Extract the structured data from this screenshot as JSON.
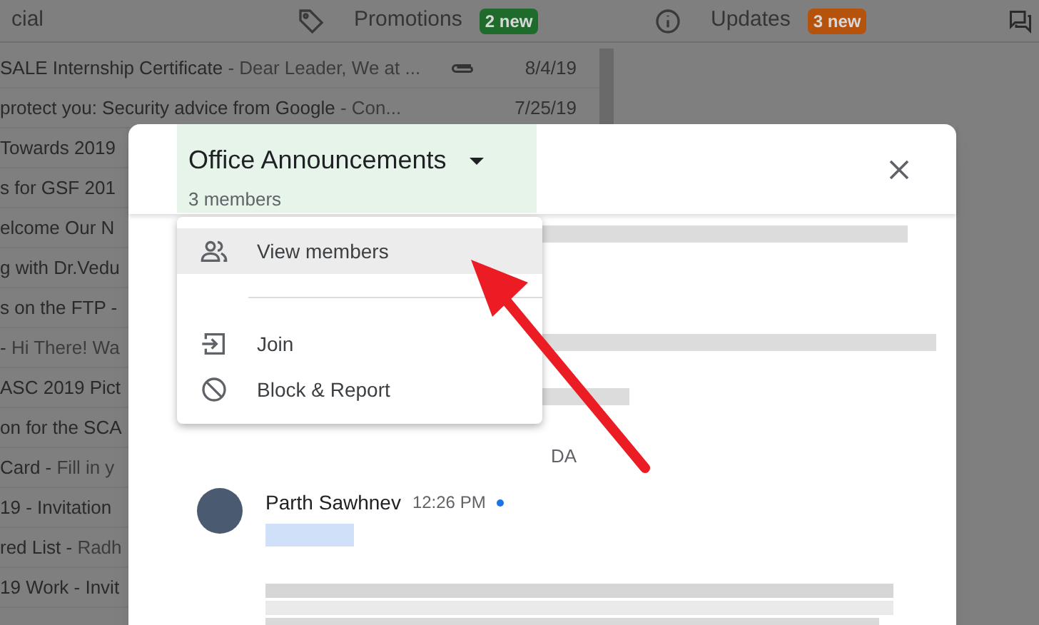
{
  "tabs": [
    {
      "label": "cial"
    },
    {
      "label": "Promotions",
      "badge": "2 new",
      "color": "#1e6b2c"
    },
    {
      "label": "Updates",
      "badge": "3 new",
      "color": "#b5520c"
    }
  ],
  "emails": [
    {
      "subject": "SALE Internship Certificate",
      "snippet": " - Dear Leader, We at ...",
      "attachment": true,
      "date": "8/4/19"
    },
    {
      "subject": "protect you: Security advice from Google",
      "snippet": " - Con...",
      "attachment": false,
      "date": "7/25/19"
    },
    {
      "subject": "Towards 2019",
      "attachment": false
    },
    {
      "subject": "s for GSF 201",
      "attachment": false
    },
    {
      "subject": "elcome Our N",
      "attachment": false
    },
    {
      "subject": "g with Dr.Vedu",
      "attachment": false
    },
    {
      "subject": "s on the FTP -",
      "attachment": false
    },
    {
      "subject": "-",
      "snippet": " Hi There! Wa",
      "attachment": false
    },
    {
      "subject": "ASC 2019 Pict",
      "attachment": false
    },
    {
      "subject": "on for the SCA",
      "attachment": false
    },
    {
      "subject": "Card -",
      "snippet": " Fill in y",
      "attachment": false
    },
    {
      "subject": "19 - Invitation",
      "attachment": false
    },
    {
      "subject": "red List -",
      "snippet": " Radh",
      "attachment": false
    },
    {
      "subject": "19 Work - Invit",
      "attachment": false
    }
  ],
  "dialog": {
    "title": "Office Announcements",
    "subtitle": "3 members",
    "menu": [
      {
        "label": "View members",
        "selected": true
      },
      {
        "label": "Join",
        "selected": false
      },
      {
        "label": "Block & Report",
        "selected": false
      }
    ],
    "fragment": "DA",
    "message": {
      "author": "Parth Sawhnev",
      "time": "12:26 PM",
      "unread": true
    }
  }
}
